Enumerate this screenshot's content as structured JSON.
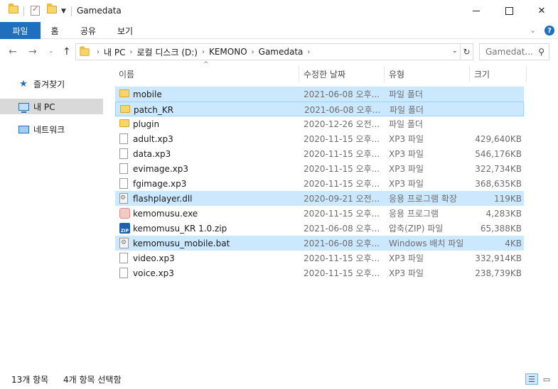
{
  "window": {
    "title": "Gamedata"
  },
  "ribbon": {
    "tabs": [
      "파일",
      "홈",
      "공유",
      "보기"
    ]
  },
  "address": {
    "crumbs": [
      "내 PC",
      "로컬 디스크 (D:)",
      "KEMONO",
      "Gamedata"
    ]
  },
  "search": {
    "placeholder": "Gamedat..."
  },
  "sidebar": {
    "items": [
      {
        "label": "즐겨찾기",
        "icon": "star-icon"
      },
      {
        "label": "내 PC",
        "icon": "pc-icon"
      },
      {
        "label": "네트워크",
        "icon": "network-icon"
      }
    ]
  },
  "columns": {
    "name": "이름",
    "date": "수정한 날짜",
    "type": "유형",
    "size": "크기"
  },
  "files": [
    {
      "name": "mobile",
      "date": "2021-06-08 오후...",
      "type": "파일 폴더",
      "size": "",
      "icon": "folder",
      "state": "selected"
    },
    {
      "name": "patch_KR",
      "date": "2021-06-08 오후...",
      "type": "파일 폴더",
      "size": "",
      "icon": "folder",
      "state": "focused"
    },
    {
      "name": "plugin",
      "date": "2020-12-26 오전...",
      "type": "파일 폴더",
      "size": "",
      "icon": "folder",
      "state": ""
    },
    {
      "name": "adult.xp3",
      "date": "2020-11-15 오후...",
      "type": "XP3 파일",
      "size": "429,640KB",
      "icon": "file",
      "state": ""
    },
    {
      "name": "data.xp3",
      "date": "2020-11-15 오후...",
      "type": "XP3 파일",
      "size": "546,176KB",
      "icon": "file",
      "state": ""
    },
    {
      "name": "evimage.xp3",
      "date": "2020-11-15 오후...",
      "type": "XP3 파일",
      "size": "322,734KB",
      "icon": "file",
      "state": ""
    },
    {
      "name": "fgimage.xp3",
      "date": "2020-11-15 오후...",
      "type": "XP3 파일",
      "size": "368,635KB",
      "icon": "file",
      "state": ""
    },
    {
      "name": "flashplayer.dll",
      "date": "2020-09-21 오전...",
      "type": "응용 프로그램 확장",
      "size": "119KB",
      "icon": "dll",
      "state": "selected"
    },
    {
      "name": "kemomusu.exe",
      "date": "2020-11-15 오후...",
      "type": "응용 프로그램",
      "size": "4,283KB",
      "icon": "exe",
      "state": ""
    },
    {
      "name": "kemomusu_KR 1.0.zip",
      "date": "2021-06-08 오후...",
      "type": "압축(ZIP) 파일",
      "size": "65,388KB",
      "icon": "zip",
      "state": ""
    },
    {
      "name": "kemomusu_mobile.bat",
      "date": "2021-06-08 오후...",
      "type": "Windows 배치 파일",
      "size": "4KB",
      "icon": "bat",
      "state": "selected"
    },
    {
      "name": "video.xp3",
      "date": "2020-11-15 오후...",
      "type": "XP3 파일",
      "size": "332,914KB",
      "icon": "file",
      "state": ""
    },
    {
      "name": "voice.xp3",
      "date": "2020-11-15 오후...",
      "type": "XP3 파일",
      "size": "238,739KB",
      "icon": "file",
      "state": ""
    }
  ],
  "status": {
    "count": "13개 항목",
    "selected": "4개 항목 선택함"
  },
  "icons": {
    "zip_label": "ZIP"
  },
  "colors": {
    "accent": "#1f6fbf",
    "selection": "#cce8ff",
    "selection_border": "#99d1ff"
  }
}
